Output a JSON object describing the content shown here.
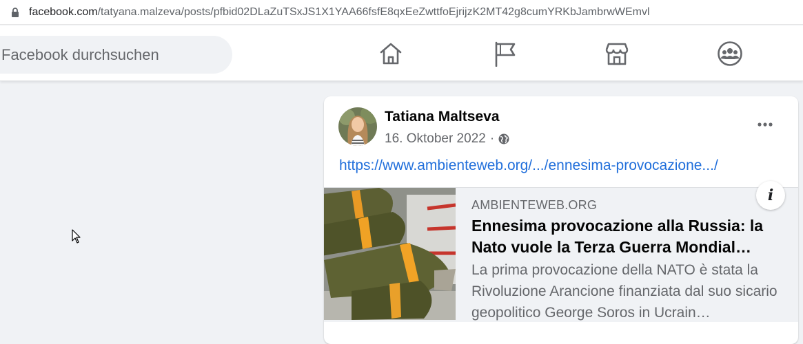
{
  "browser": {
    "url_domain": "facebook.com",
    "url_path": "/tatyana.malzeva/posts/pfbid02DLaZuTSxJS1X1YAA66fsfE8qxEeZwttfoEjrijzK2MT42g8cumYRKbJambrwWEmvl"
  },
  "header": {
    "search_placeholder": "Facebook durchsuchen",
    "nav_icons": [
      "home-icon",
      "pages-flag-icon",
      "marketplace-icon",
      "groups-icon"
    ]
  },
  "post": {
    "author": "Tatiana Maltseva",
    "date": "16. Oktober 2022",
    "separator": "·",
    "privacy_icon": "globe-icon",
    "link_text": "https://www.ambienteweb.org/.../ennesima-provocazione.../",
    "preview": {
      "site": "AMBIENTEWEB.ORG",
      "headline": "Ennesima provocazione alla Russia: la Nato vuole la Terza Guerra Mondial…",
      "description": "La prima provocazione della NATO è stata la Rivoluzione Arancione finanziata dal suo sicario geopolitico George Soros in Ucrain…"
    }
  },
  "colors": {
    "link": "#216fdb",
    "secondary_text": "#65676b",
    "page_bg": "#f0f2f5"
  }
}
